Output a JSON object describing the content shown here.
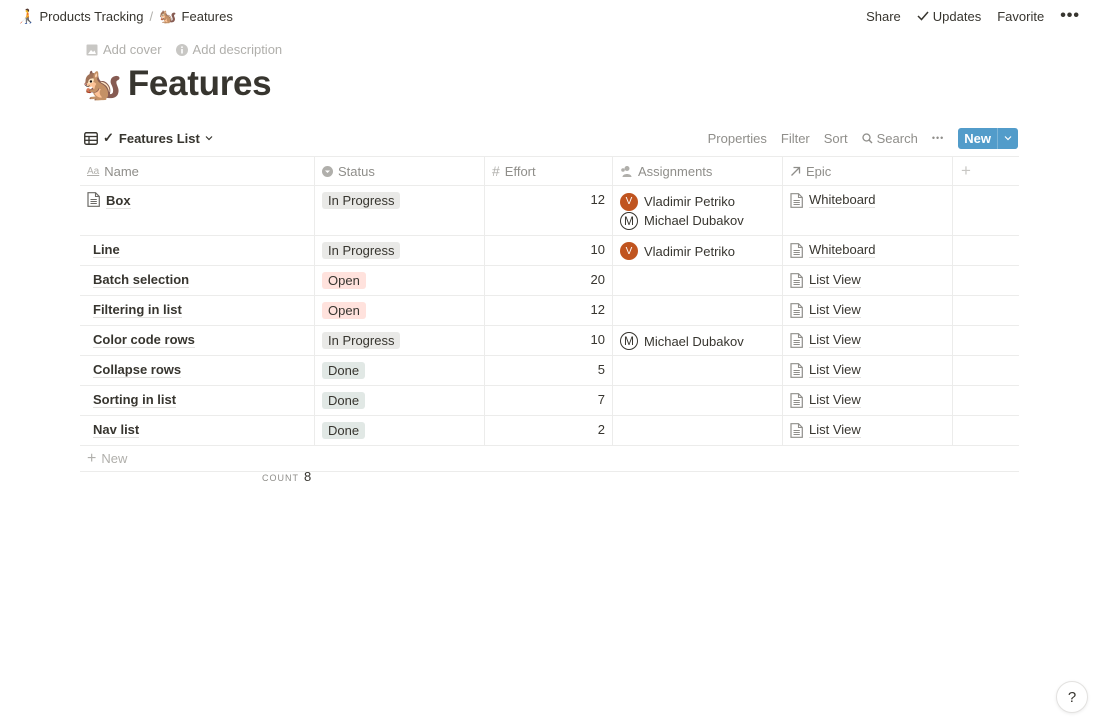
{
  "breadcrumb": [
    {
      "emoji": "🧑‍🦯",
      "label": "Products Tracking"
    },
    {
      "emoji": "🐿️",
      "label": "Features"
    }
  ],
  "breadcrumb_separator": "/",
  "top_actions": {
    "share": "Share",
    "updates": "Updates",
    "favorite": "Favorite",
    "more": "•••"
  },
  "page_meta": {
    "add_cover": "Add cover",
    "add_description": "Add description"
  },
  "page": {
    "emoji": "🐿️",
    "title": "Features"
  },
  "view": {
    "name": "Features List",
    "check": "✓",
    "actions": {
      "properties": "Properties",
      "filter": "Filter",
      "sort": "Sort",
      "search": "Search",
      "more": "•••",
      "new": "New"
    }
  },
  "table": {
    "columns": [
      {
        "label": "Name",
        "icon": "text-type-icon"
      },
      {
        "label": "Status",
        "icon": "select-icon"
      },
      {
        "label": "Effort",
        "icon": "number-icon"
      },
      {
        "label": "Assignments",
        "icon": "person-icon"
      },
      {
        "label": "Epic",
        "icon": "relation-arrow-icon"
      }
    ],
    "add_column": "+",
    "rows": [
      {
        "name": "Box",
        "has_page_icon": true,
        "status": "In Progress",
        "effort": "12",
        "assignments": [
          {
            "initial": "V",
            "name": "Vladimir Petriko",
            "style": "v"
          },
          {
            "initial": "M",
            "name": "Michael Dubakov",
            "style": "m"
          }
        ],
        "epic": "Whiteboard"
      },
      {
        "name": "Line",
        "status": "In Progress",
        "effort": "10",
        "assignments": [
          {
            "initial": "V",
            "name": "Vladimir Petriko",
            "style": "v"
          }
        ],
        "epic": "Whiteboard"
      },
      {
        "name": "Batch selection",
        "status": "Open",
        "effort": "20",
        "assignments": [],
        "epic": "List View"
      },
      {
        "name": "Filtering in list",
        "status": "Open",
        "effort": "12",
        "assignments": [],
        "epic": "List View"
      },
      {
        "name": "Color code rows",
        "status": "In Progress",
        "effort": "10",
        "assignments": [
          {
            "initial": "M",
            "name": "Michael Dubakov",
            "style": "m"
          }
        ],
        "epic": "List View"
      },
      {
        "name": "Collapse rows",
        "status": "Done",
        "effort": "5",
        "assignments": [],
        "epic": "List View"
      },
      {
        "name": "Sorting in list",
        "status": "Done",
        "effort": "7",
        "assignments": [],
        "epic": "List View"
      },
      {
        "name": "Nav list",
        "status": "Done",
        "effort": "2",
        "assignments": [],
        "epic": "List View"
      }
    ],
    "new_row": "New",
    "count_label": "COUNT",
    "count_value": "8"
  },
  "status_colors": {
    "In Progress": "#e9e9e7",
    "Open": "#ffe2dd",
    "Done": "#e1e8e5"
  },
  "accent_color": "#529cca",
  "help": "?"
}
